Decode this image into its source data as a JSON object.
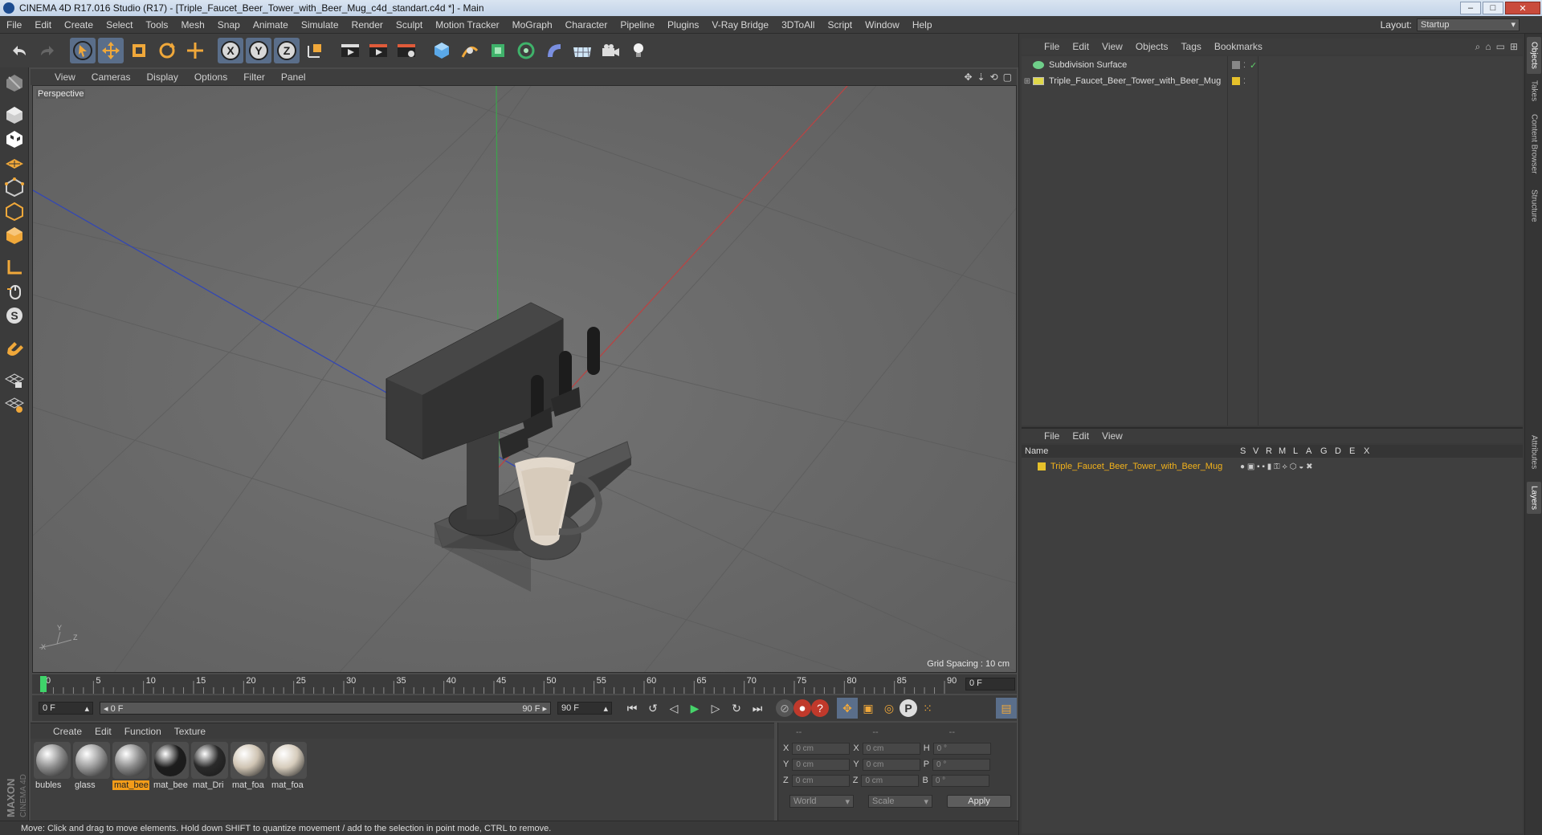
{
  "window": {
    "title": "CINEMA 4D R17.016 Studio (R17) - [Triple_Faucet_Beer_Tower_with_Beer_Mug_c4d_standart.c4d *] - Main",
    "minimize": "–",
    "maximize": "□",
    "close": "✕"
  },
  "menubar": {
    "items": [
      "File",
      "Edit",
      "Create",
      "Select",
      "Tools",
      "Mesh",
      "Snap",
      "Animate",
      "Simulate",
      "Render",
      "Sculpt",
      "Motion Tracker",
      "MoGraph",
      "Character",
      "Pipeline",
      "Plugins",
      "V-Ray Bridge",
      "3DToAll",
      "Script",
      "Window",
      "Help"
    ],
    "layout_label": "Layout:",
    "layout_value": "Startup"
  },
  "viewport": {
    "menu": [
      "View",
      "Cameras",
      "Display",
      "Options",
      "Filter",
      "Panel"
    ],
    "camera_label": "Perspective",
    "grid_spacing": "Grid Spacing : 10 cm",
    "axis_x": "X",
    "axis_y": "Y",
    "axis_z": "Z"
  },
  "timeline": {
    "ticks": [
      "0",
      "5",
      "10",
      "15",
      "20",
      "25",
      "30",
      "35",
      "40",
      "45",
      "50",
      "55",
      "60",
      "65",
      "70",
      "75",
      "80",
      "85",
      "90"
    ],
    "current_frame": "0 F",
    "start_frame": "0 F",
    "range_start": "0 F",
    "range_end": "90 F",
    "end_frame": "90 F",
    "playhead_frame": 0
  },
  "materials": {
    "menu": [
      "Create",
      "Edit",
      "Function",
      "Texture"
    ],
    "items": [
      {
        "label": "bubles",
        "color": "#8d8d8d",
        "active": false
      },
      {
        "label": "glass",
        "color": "#9a9a9a",
        "active": false
      },
      {
        "label": "mat_bee",
        "color": "#8a8a8a",
        "active": true
      },
      {
        "label": "mat_bee",
        "color": "#1d1d1d",
        "active": false
      },
      {
        "label": "mat_Dri",
        "color": "#2a2a2a",
        "active": false
      },
      {
        "label": "mat_foa",
        "color": "#cfc4b3",
        "active": false
      },
      {
        "label": "mat_foa",
        "color": "#d6ccbc",
        "active": false
      }
    ]
  },
  "coordinates": {
    "header": [
      "--",
      "--",
      "--"
    ],
    "rows": [
      {
        "a": "X",
        "av": "0 cm",
        "b": "X",
        "bv": "0 cm",
        "c": "H",
        "cv": "0 °"
      },
      {
        "a": "Y",
        "av": "0 cm",
        "b": "Y",
        "bv": "0 cm",
        "c": "P",
        "cv": "0 °"
      },
      {
        "a": "Z",
        "av": "0 cm",
        "b": "Z",
        "bv": "0 cm",
        "c": "B",
        "cv": "0 °"
      }
    ],
    "space": "World",
    "mode": "Scale",
    "apply": "Apply"
  },
  "status": "Move: Click and drag to move elements. Hold down SHIFT to quantize movement / add to the selection in point mode, CTRL to remove.",
  "brand": "MAXON CINEMA 4D",
  "object_manager": {
    "menu": [
      "File",
      "Edit",
      "View",
      "Objects",
      "Tags",
      "Bookmarks"
    ],
    "objects": [
      {
        "name": "Subdivision Surface",
        "icon_color": "#6fcf8a"
      },
      {
        "name": "Triple_Faucet_Beer_Tower_with_Beer_Mug",
        "icon_color": "#e0d84a"
      }
    ]
  },
  "layer_manager": {
    "menu": [
      "File",
      "Edit",
      "View"
    ],
    "columns": [
      "Name",
      "S",
      "V",
      "R",
      "M",
      "L",
      "A",
      "G",
      "D",
      "E",
      "X"
    ],
    "layers": [
      {
        "name": "Triple_Faucet_Beer_Tower_with_Beer_Mug",
        "color": "#e6c12b"
      }
    ]
  },
  "side_tabs": [
    "Objects",
    "Takes",
    "Content Browser",
    "Structure",
    "Attributes",
    "Layers"
  ],
  "colors": {
    "accent": "#f39c19",
    "selection": "#5a6e8a",
    "viewport_bg": "#6b6b6b"
  }
}
